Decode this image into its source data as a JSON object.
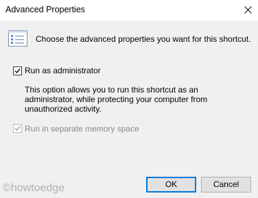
{
  "window": {
    "title": "Advanced Properties",
    "close_icon": "close-icon"
  },
  "header": {
    "icon": "properties-list-icon",
    "text": "Choose the advanced properties you want for this shortcut."
  },
  "options": {
    "run_as_admin": {
      "label": "Run as administrator",
      "checked": true,
      "enabled": true,
      "description": "This option allows you to run this shortcut as an administrator, while protecting your computer from unauthorized activity."
    },
    "separate_memory": {
      "label": "Run in separate memory space",
      "checked": true,
      "enabled": false
    }
  },
  "buttons": {
    "ok": "OK",
    "cancel": "Cancel"
  },
  "watermark": "©howtoedge",
  "colors": {
    "accent": "#0078d7",
    "disabled_text": "#8a8a8a"
  }
}
